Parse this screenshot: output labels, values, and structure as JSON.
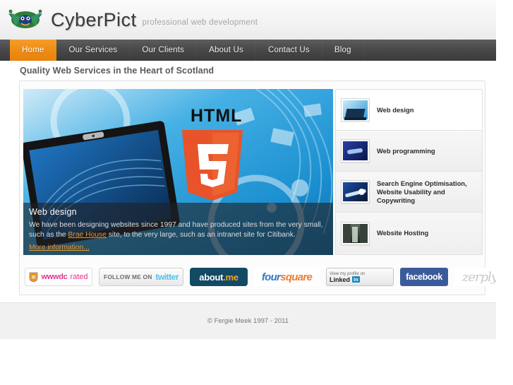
{
  "brand": {
    "logo_icon": "cyberpict-mascot-icon",
    "title": "CyberPict",
    "tagline": "professional web development"
  },
  "nav": {
    "items": [
      {
        "label": "Home",
        "active": true
      },
      {
        "label": "Our Services",
        "active": false
      },
      {
        "label": "Our Clients",
        "active": false
      },
      {
        "label": "About Us",
        "active": false
      },
      {
        "label": "Contact Us",
        "active": false
      },
      {
        "label": "Blog",
        "active": false
      }
    ]
  },
  "page": {
    "heading": "Quality Web Services in the Heart of Scotland"
  },
  "banner": {
    "image_alt": "laptop with HTML5 logo on blue background",
    "html5_label": "HTML",
    "html5_number": "5",
    "caption_title": "Web design",
    "caption_line1": "We have been designing websites since 1997 and have produced sites from the very small,",
    "caption_line2_before": "such as the ",
    "caption_link": "Brae House",
    "caption_line2_after": " site, to the very large, such as an intranet site for Citibank.",
    "more_link": "More information..."
  },
  "services_list": [
    {
      "label": "Web design",
      "thumb": "laptop-thumb-icon",
      "active": true
    },
    {
      "label": "Web programming",
      "thumb": "code-thumb-icon",
      "active": false
    },
    {
      "label": "Search Engine Optimisation, Website Usability and Copywriting",
      "thumb": "seo-thumb-icon",
      "active": false
    },
    {
      "label": "Website Hosting",
      "thumb": "server-room-thumb-icon",
      "active": false
    }
  ],
  "badges": [
    {
      "name": "wwwdc-rated-badge",
      "left": "wwwdc",
      "right": "rated"
    },
    {
      "name": "twitter-badge",
      "left": "FOLLOW ME ON",
      "right": "twitter"
    },
    {
      "name": "aboutme-badge",
      "left": "about",
      "right": ".me"
    },
    {
      "name": "foursquare-badge",
      "left": "four",
      "right": "square"
    },
    {
      "name": "linkedin-badge",
      "top": "View my profile on",
      "left": "Linked",
      "right": "in"
    },
    {
      "name": "facebook-badge",
      "label": "facebook"
    },
    {
      "name": "zerply-badge",
      "label": "zerply"
    }
  ],
  "footer": {
    "copyright": "© Fergie Meek 1997 - 2011"
  },
  "colors": {
    "accent_orange": "#ef8c14",
    "nav_dark": "#4b4b4b",
    "brand_text": "#3a3a3a",
    "tagline_gray": "#a5a5a5",
    "footer_bg": "#f1f1f1",
    "link_orange": "#e9962f"
  }
}
